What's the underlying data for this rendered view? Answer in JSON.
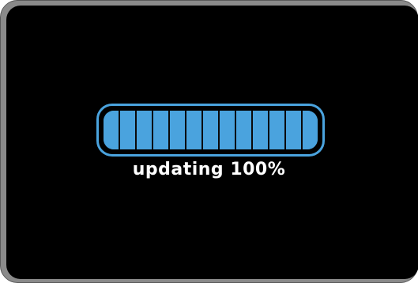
{
  "update": {
    "status_label": "updating 100%",
    "progress_percent": 100,
    "segment_count": 13
  },
  "colors": {
    "screen_background": "#000000",
    "progress_accent": "#4aa3de",
    "text": "#ffffff",
    "frame": "#8a8a8a"
  }
}
